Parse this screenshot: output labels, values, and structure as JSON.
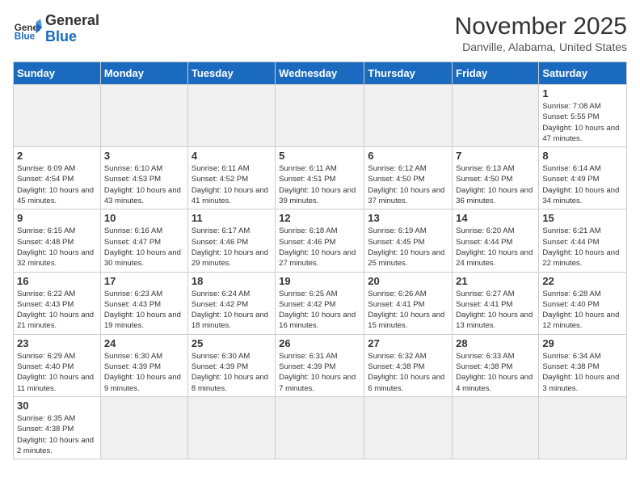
{
  "header": {
    "logo_general": "General",
    "logo_blue": "Blue",
    "month_title": "November 2025",
    "location": "Danville, Alabama, United States"
  },
  "days_of_week": [
    "Sunday",
    "Monday",
    "Tuesday",
    "Wednesday",
    "Thursday",
    "Friday",
    "Saturday"
  ],
  "weeks": [
    [
      {
        "num": "",
        "info": ""
      },
      {
        "num": "",
        "info": ""
      },
      {
        "num": "",
        "info": ""
      },
      {
        "num": "",
        "info": ""
      },
      {
        "num": "",
        "info": ""
      },
      {
        "num": "",
        "info": ""
      },
      {
        "num": "1",
        "info": "Sunrise: 7:08 AM\nSunset: 5:55 PM\nDaylight: 10 hours and 47 minutes."
      }
    ],
    [
      {
        "num": "2",
        "info": "Sunrise: 6:09 AM\nSunset: 4:54 PM\nDaylight: 10 hours and 45 minutes."
      },
      {
        "num": "3",
        "info": "Sunrise: 6:10 AM\nSunset: 4:53 PM\nDaylight: 10 hours and 43 minutes."
      },
      {
        "num": "4",
        "info": "Sunrise: 6:11 AM\nSunset: 4:52 PM\nDaylight: 10 hours and 41 minutes."
      },
      {
        "num": "5",
        "info": "Sunrise: 6:11 AM\nSunset: 4:51 PM\nDaylight: 10 hours and 39 minutes."
      },
      {
        "num": "6",
        "info": "Sunrise: 6:12 AM\nSunset: 4:50 PM\nDaylight: 10 hours and 37 minutes."
      },
      {
        "num": "7",
        "info": "Sunrise: 6:13 AM\nSunset: 4:50 PM\nDaylight: 10 hours and 36 minutes."
      },
      {
        "num": "8",
        "info": "Sunrise: 6:14 AM\nSunset: 4:49 PM\nDaylight: 10 hours and 34 minutes."
      }
    ],
    [
      {
        "num": "9",
        "info": "Sunrise: 6:15 AM\nSunset: 4:48 PM\nDaylight: 10 hours and 32 minutes."
      },
      {
        "num": "10",
        "info": "Sunrise: 6:16 AM\nSunset: 4:47 PM\nDaylight: 10 hours and 30 minutes."
      },
      {
        "num": "11",
        "info": "Sunrise: 6:17 AM\nSunset: 4:46 PM\nDaylight: 10 hours and 29 minutes."
      },
      {
        "num": "12",
        "info": "Sunrise: 6:18 AM\nSunset: 4:46 PM\nDaylight: 10 hours and 27 minutes."
      },
      {
        "num": "13",
        "info": "Sunrise: 6:19 AM\nSunset: 4:45 PM\nDaylight: 10 hours and 25 minutes."
      },
      {
        "num": "14",
        "info": "Sunrise: 6:20 AM\nSunset: 4:44 PM\nDaylight: 10 hours and 24 minutes."
      },
      {
        "num": "15",
        "info": "Sunrise: 6:21 AM\nSunset: 4:44 PM\nDaylight: 10 hours and 22 minutes."
      }
    ],
    [
      {
        "num": "16",
        "info": "Sunrise: 6:22 AM\nSunset: 4:43 PM\nDaylight: 10 hours and 21 minutes."
      },
      {
        "num": "17",
        "info": "Sunrise: 6:23 AM\nSunset: 4:43 PM\nDaylight: 10 hours and 19 minutes."
      },
      {
        "num": "18",
        "info": "Sunrise: 6:24 AM\nSunset: 4:42 PM\nDaylight: 10 hours and 18 minutes."
      },
      {
        "num": "19",
        "info": "Sunrise: 6:25 AM\nSunset: 4:42 PM\nDaylight: 10 hours and 16 minutes."
      },
      {
        "num": "20",
        "info": "Sunrise: 6:26 AM\nSunset: 4:41 PM\nDaylight: 10 hours and 15 minutes."
      },
      {
        "num": "21",
        "info": "Sunrise: 6:27 AM\nSunset: 4:41 PM\nDaylight: 10 hours and 13 minutes."
      },
      {
        "num": "22",
        "info": "Sunrise: 6:28 AM\nSunset: 4:40 PM\nDaylight: 10 hours and 12 minutes."
      }
    ],
    [
      {
        "num": "23",
        "info": "Sunrise: 6:29 AM\nSunset: 4:40 PM\nDaylight: 10 hours and 11 minutes."
      },
      {
        "num": "24",
        "info": "Sunrise: 6:30 AM\nSunset: 4:39 PM\nDaylight: 10 hours and 9 minutes."
      },
      {
        "num": "25",
        "info": "Sunrise: 6:30 AM\nSunset: 4:39 PM\nDaylight: 10 hours and 8 minutes."
      },
      {
        "num": "26",
        "info": "Sunrise: 6:31 AM\nSunset: 4:39 PM\nDaylight: 10 hours and 7 minutes."
      },
      {
        "num": "27",
        "info": "Sunrise: 6:32 AM\nSunset: 4:38 PM\nDaylight: 10 hours and 6 minutes."
      },
      {
        "num": "28",
        "info": "Sunrise: 6:33 AM\nSunset: 4:38 PM\nDaylight: 10 hours and 4 minutes."
      },
      {
        "num": "29",
        "info": "Sunrise: 6:34 AM\nSunset: 4:38 PM\nDaylight: 10 hours and 3 minutes."
      }
    ],
    [
      {
        "num": "30",
        "info": "Sunrise: 6:35 AM\nSunset: 4:38 PM\nDaylight: 10 hours and 2 minutes."
      },
      {
        "num": "",
        "info": ""
      },
      {
        "num": "",
        "info": ""
      },
      {
        "num": "",
        "info": ""
      },
      {
        "num": "",
        "info": ""
      },
      {
        "num": "",
        "info": ""
      },
      {
        "num": "",
        "info": ""
      }
    ]
  ]
}
